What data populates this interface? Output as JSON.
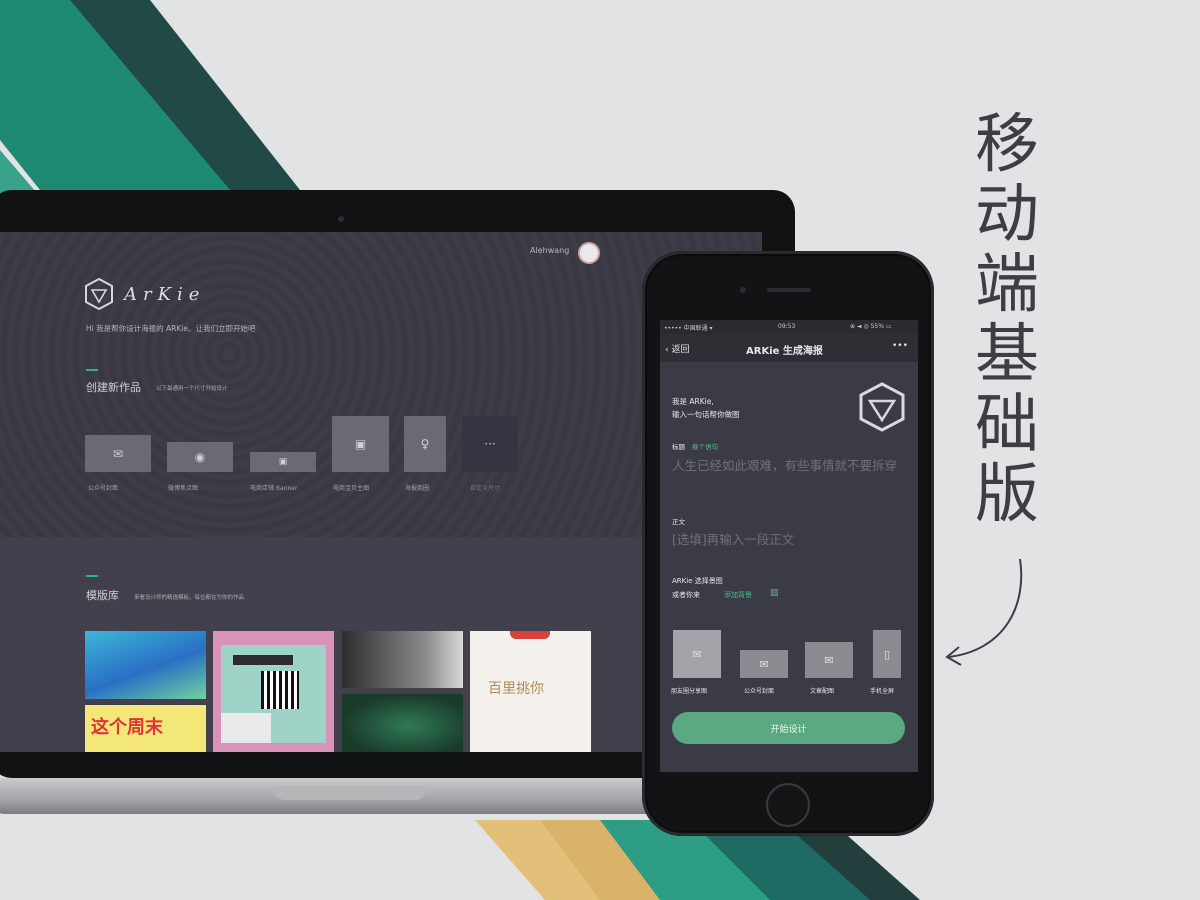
{
  "vertical_title": [
    "移",
    "动",
    "端",
    "基",
    "础",
    "版"
  ],
  "laptop": {
    "user_name": "Alehwang",
    "logo_text": "ArKie",
    "intro": "Hi 我是帮你设计海报的 ARKie。让我们立即开始吧",
    "create_section": {
      "title": "创建新作品",
      "subtitle": "以下最通用一个尺寸开始设计",
      "items": [
        {
          "label": "公众号封面",
          "icon": "wechat-icon"
        },
        {
          "label": "微博焦点图",
          "icon": "weibo-icon"
        },
        {
          "label": "电商店铺 Banner",
          "icon": "image-icon"
        },
        {
          "label": "电商宝贝主图",
          "icon": "image-icon"
        },
        {
          "label": "海报朋圈",
          "icon": "lightbulb-icon"
        },
        {
          "label": "自定义尺寸",
          "icon": "more-icon"
        }
      ],
      "more_symbol": "···"
    },
    "template_section": {
      "title": "模版库",
      "subtitle": "来看设计师的精选模板，每位都在为你的作品"
    },
    "thumbnails": {
      "poster1_text": "这个周末",
      "poster2_text": "百里挑你"
    }
  },
  "phone": {
    "status": {
      "carrier": "••••• 中国联通 ▾",
      "time": "09:53",
      "battery": "⊕ ◄ ◎ 55% ▭"
    },
    "nav": {
      "back_label": "返回",
      "title": "ARKie 生成海报",
      "more": "•••"
    },
    "greeting_line1": "我是 ARKie,",
    "greeting_line2": "输入一句话帮你做图",
    "headline_label": "标题",
    "headline_tag": "换个语句",
    "headline_placeholder": "人生已经如此艰难，有些事情就不要拆穿",
    "body_label": "正文",
    "body_placeholder": "[选填]再输入一段正文",
    "bg_label": "ARKie 选择景图",
    "bg_hint": "或者你来",
    "bg_add": "添加背景",
    "options": [
      {
        "label": "朋友圈分享图",
        "icon": "wechat-icon"
      },
      {
        "label": "公众号封面",
        "icon": "wechat-icon"
      },
      {
        "label": "文章配图",
        "icon": "wechat-icon"
      },
      {
        "label": "手机全屏",
        "icon": "phone-icon"
      }
    ],
    "start_button": "开始设计"
  },
  "colors": {
    "accent": "#46c08c",
    "button": "#5aa980",
    "screen_bg": "#3b3b45"
  }
}
